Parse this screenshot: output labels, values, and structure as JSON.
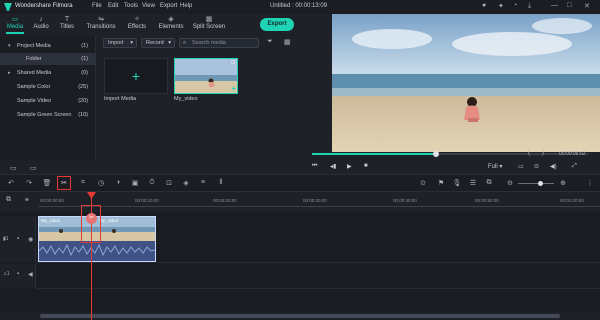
{
  "app": {
    "name": "Wondershare Filmora",
    "doc_title": "Untitled : 00:00:13:09"
  },
  "menu": [
    "File",
    "Edit",
    "Tools",
    "View",
    "Export",
    "Help"
  ],
  "tabs": [
    {
      "label": "Media",
      "icon": "folder-icon",
      "active": true
    },
    {
      "label": "Audio",
      "icon": "music-note-icon",
      "active": false
    },
    {
      "label": "Titles",
      "icon": "text-icon",
      "active": false
    },
    {
      "label": "Transitions",
      "icon": "transition-icon",
      "active": false
    },
    {
      "label": "Effects",
      "icon": "effects-icon",
      "active": false
    },
    {
      "label": "Elements",
      "icon": "elements-icon",
      "active": false
    },
    {
      "label": "Split Screen",
      "icon": "split-screen-icon",
      "active": false
    }
  ],
  "export_label": "Export",
  "left_panel": {
    "items": [
      {
        "label": "Project Media",
        "count": "(1)",
        "expanded": true
      },
      {
        "label": "Folder",
        "count": "(1)",
        "selected": true
      },
      {
        "label": "Shared Media",
        "count": "(0)"
      },
      {
        "label": "Sample Color",
        "count": "(25)"
      },
      {
        "label": "Sample Video",
        "count": "(20)"
      },
      {
        "label": "Sample Green Screen",
        "count": "(10)"
      }
    ]
  },
  "media": {
    "import_dropdown": "Import",
    "record_dropdown": "Record",
    "search_placeholder": "Search media",
    "import_label": "Import Media",
    "video_label": "My_video"
  },
  "preview": {
    "progress": 0.45,
    "timecode": "00:00:06:02",
    "quality": "Full"
  },
  "timeline": {
    "ruler_labels": [
      "00:00:00:00",
      "00:00:10:00",
      "00:00:20:00",
      "00:00:30:00",
      "00:00:40:00",
      "00:00:50:00",
      "00:01:00:00"
    ]
  },
  "colors": {
    "accent": "#1fd3b5",
    "playhead": "#e53935",
    "clip": "#2f3f66"
  }
}
